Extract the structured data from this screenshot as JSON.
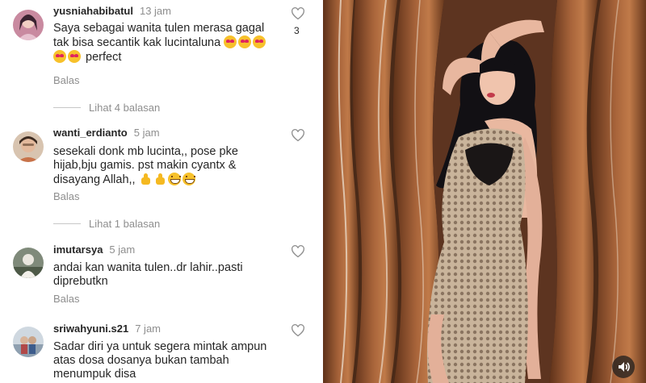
{
  "comments": [
    {
      "username": "yusniahabibatul",
      "time": "13 jam",
      "line1": "Saya sebagai wanita tulen merasa gagal",
      "line2": "tak bisa secantik kak lucintaluna",
      "line3": "perfect",
      "reply": "Balas",
      "likes": "3",
      "view_replies": "Lihat 4 balasan"
    },
    {
      "username": "wanti_erdianto",
      "time": "5 jam",
      "line1": "sesekali donk mb lucinta,, pose pke",
      "line2": "hijab,bju gamis. pst makin cyantx &",
      "line3": "disayang Allah,,",
      "reply": "Balas",
      "view_replies": "Lihat 1 balasan"
    },
    {
      "username": "imutarsya",
      "time": "5 jam",
      "line1": "andai kan wanita tulen..dr lahir..pasti",
      "line2": "diprebutkn",
      "reply": "Balas"
    },
    {
      "username": "sriwahyuni.s21",
      "time": "7 jam",
      "line1": "Sadar diri ya untuk segera mintak ampun",
      "line2": "atas dosa dosanya bukan tambah",
      "line3": "menumpuk disa"
    }
  ],
  "icons": {
    "like": "heart-outline-icon",
    "emoji_love": "heart-eyes-emoji",
    "emoji_thumb": "thumbs-up-emoji",
    "emoji_grin": "grinning-emoji",
    "volume": "speaker-icon"
  },
  "colors": {
    "text": "#262626",
    "muted": "#8e8e8e",
    "wood": "#8a4f2b"
  }
}
